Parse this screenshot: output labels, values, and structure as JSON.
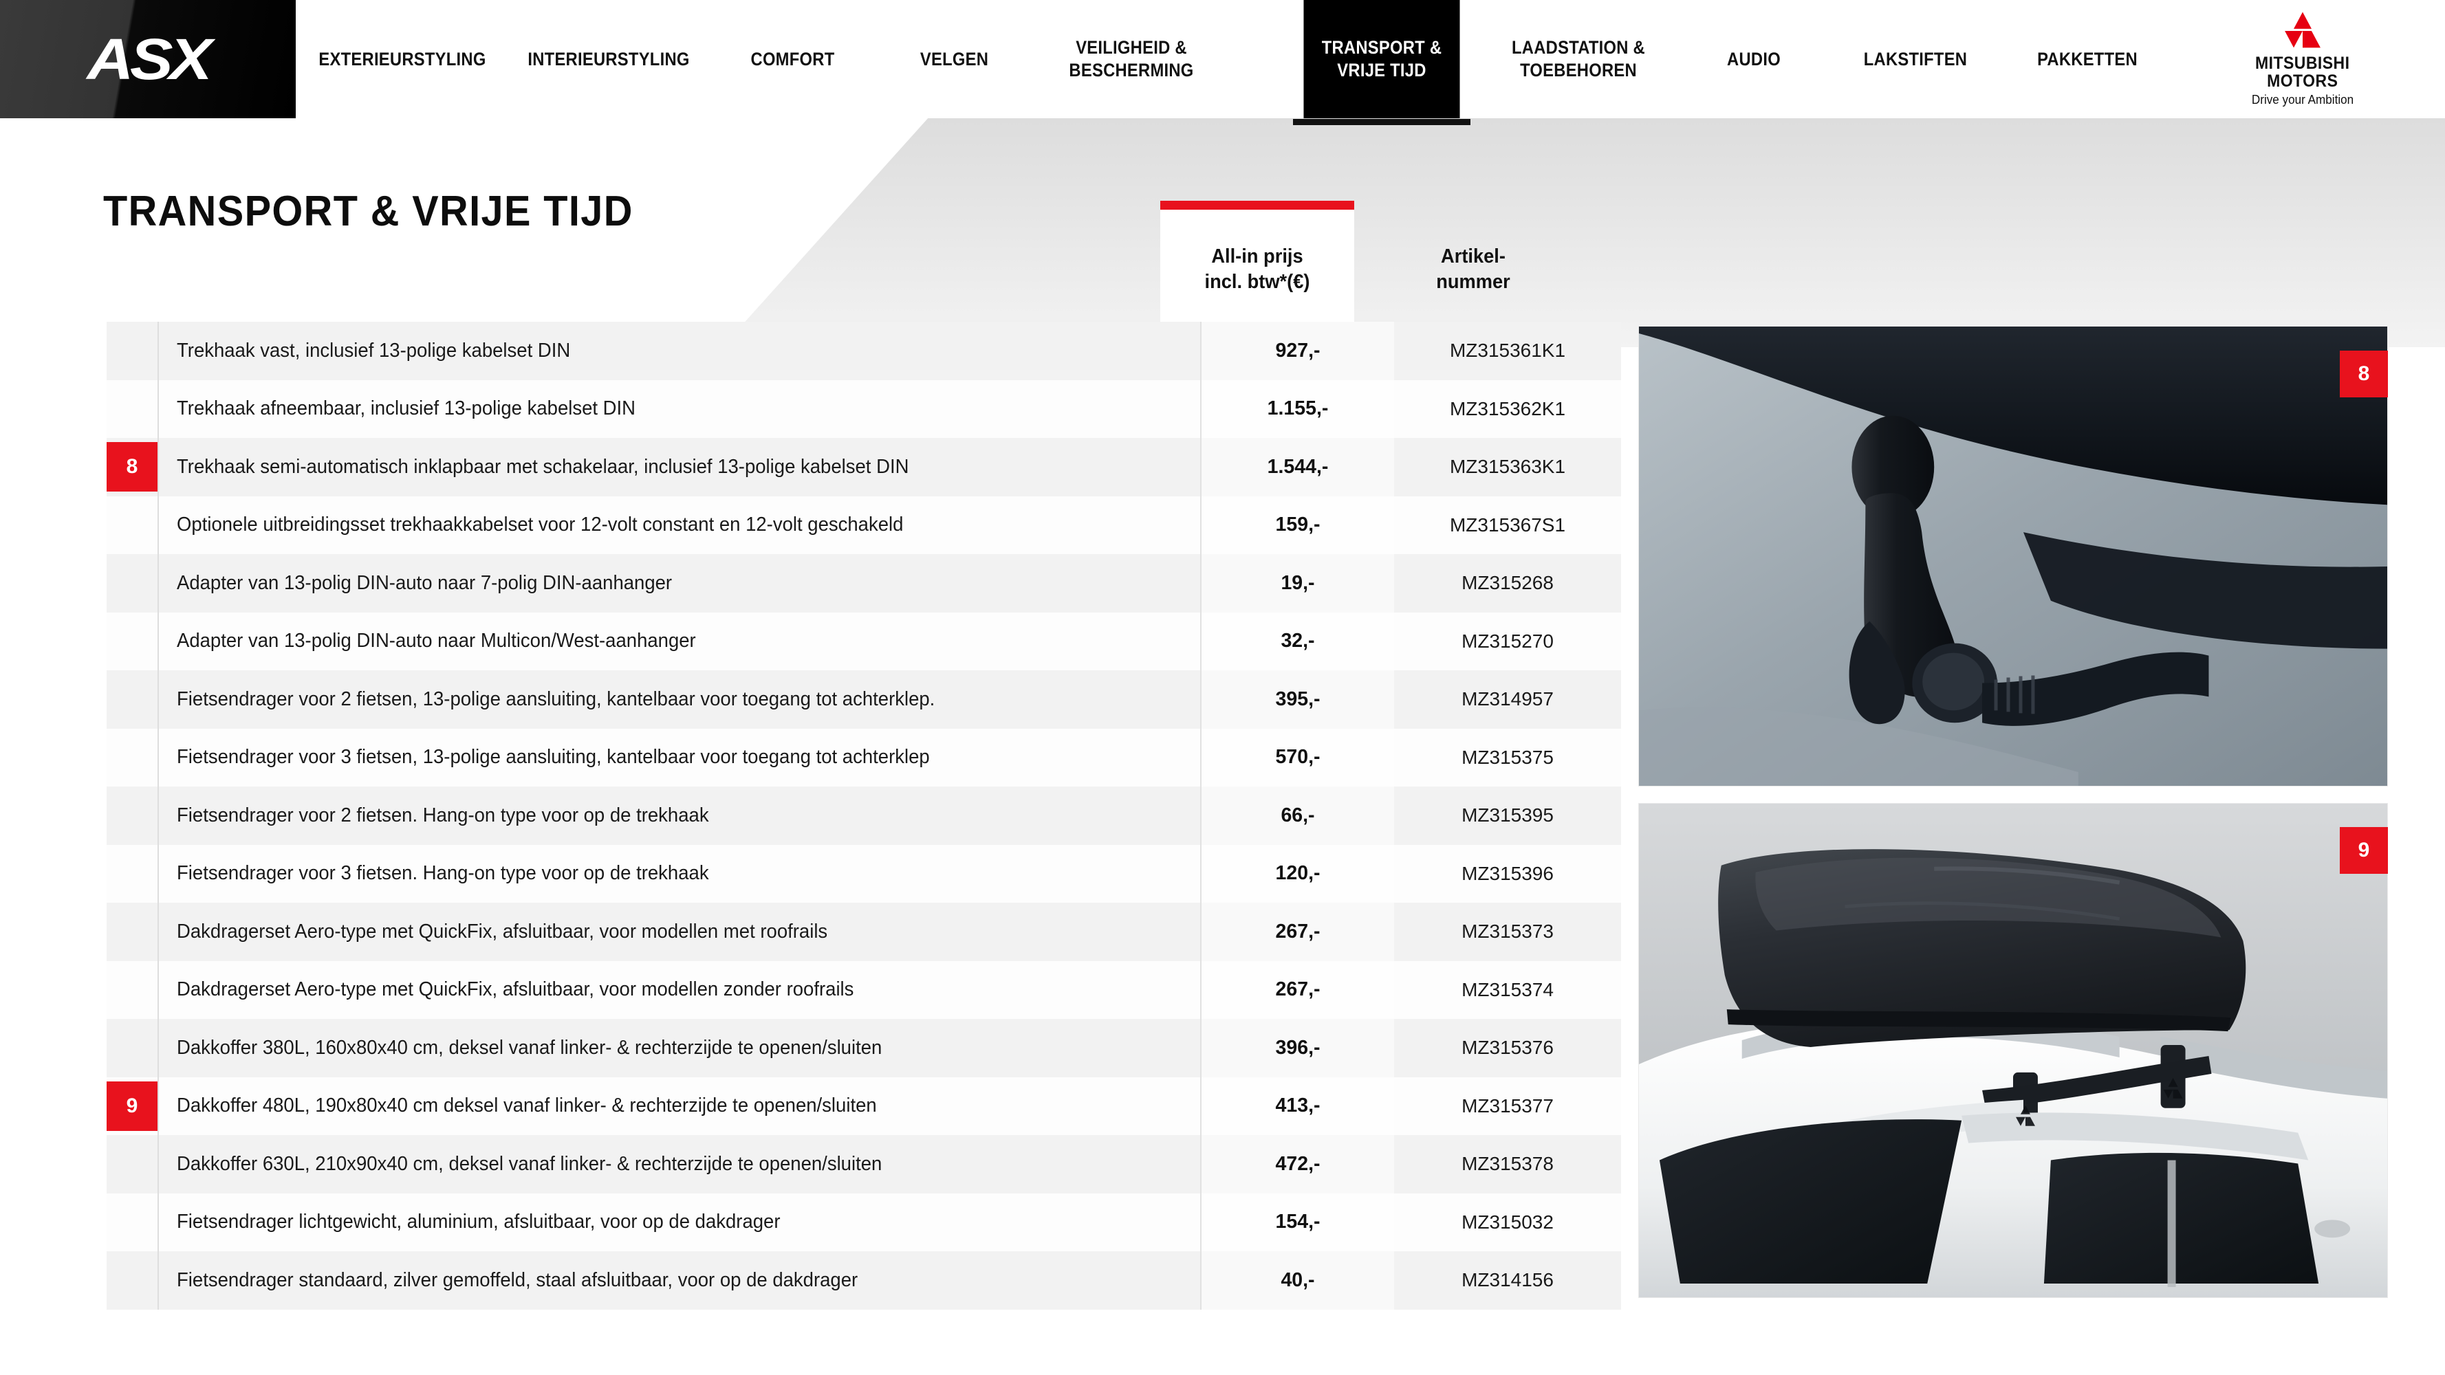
{
  "brand": {
    "model_logo": "ASX",
    "manufacturer_line1": "MITSUBISHI",
    "manufacturer_line2": "MOTORS",
    "tagline": "Drive your Ambition",
    "accent_red": "#e8121d",
    "logo_red": "#e60012"
  },
  "nav": {
    "items": [
      {
        "label": "EXTERIEURSTYLING",
        "active": false
      },
      {
        "label": "INTERIEURSTYLING",
        "active": false
      },
      {
        "label": "COMFORT",
        "active": false
      },
      {
        "label": "VELGEN",
        "active": false
      },
      {
        "label": "VEILIGHEID &\nBESCHERMING",
        "active": false
      },
      {
        "label": "TRANSPORT &\nVRIJE TIJD",
        "active": true
      },
      {
        "label": "LAADSTATION &\nTOEBEHOREN",
        "active": false
      },
      {
        "label": "AUDIO",
        "active": false
      },
      {
        "label": "LAKSTIFTEN",
        "active": false
      },
      {
        "label": "PAKKETTEN",
        "active": false
      }
    ]
  },
  "page": {
    "title": "TRANSPORT & VRIJE TIJD"
  },
  "table": {
    "headers": {
      "description": "",
      "price": "All-in prijs\nincl. btw*(€)",
      "article": "Artikel-\nnummer"
    },
    "rows": [
      {
        "badge": "",
        "description": "Trekhaak vast, inclusief 13-polige kabelset DIN",
        "price": "927,-",
        "article": "MZ315361K1"
      },
      {
        "badge": "",
        "description": "Trekhaak afneembaar, inclusief 13-polige kabelset DIN",
        "price": "1.155,-",
        "article": "MZ315362K1"
      },
      {
        "badge": "8",
        "description": "Trekhaak semi-automatisch inklapbaar met schakelaar, inclusief 13-polige kabelset DIN",
        "price": "1.544,-",
        "article": "MZ315363K1"
      },
      {
        "badge": "",
        "description": "Optionele uitbreidingsset trekhaakkabelset voor 12-volt constant en 12-volt geschakeld",
        "price": "159,-",
        "article": "MZ315367S1"
      },
      {
        "badge": "",
        "description": "Adapter van 13-polig DIN-auto naar 7-polig DIN-aanhanger",
        "price": "19,-",
        "article": "MZ315268"
      },
      {
        "badge": "",
        "description": "Adapter van 13-polig DIN-auto naar Multicon/West-aanhanger",
        "price": "32,-",
        "article": "MZ315270"
      },
      {
        "badge": "",
        "description": "Fietsendrager voor 2 fietsen, 13-polige aansluiting, kantelbaar voor toegang tot achterklep.",
        "price": "395,-",
        "article": "MZ314957"
      },
      {
        "badge": "",
        "description": "Fietsendrager voor 3 fietsen, 13-polige aansluiting, kantelbaar voor toegang tot achterklep",
        "price": "570,-",
        "article": "MZ315375"
      },
      {
        "badge": "",
        "description": "Fietsendrager voor 2 fietsen. Hang-on type voor op de trekhaak",
        "price": "66,-",
        "article": "MZ315395"
      },
      {
        "badge": "",
        "description": "Fietsendrager voor 3 fietsen. Hang-on type voor op de trekhaak",
        "price": "120,-",
        "article": "MZ315396"
      },
      {
        "badge": "",
        "description": "Dakdragerset Aero-type met QuickFix, afsluitbaar, voor modellen met roofrails",
        "price": "267,-",
        "article": "MZ315373"
      },
      {
        "badge": "",
        "description": "Dakdragerset Aero-type met QuickFix, afsluitbaar, voor modellen zonder roofrails",
        "price": "267,-",
        "article": "MZ315374"
      },
      {
        "badge": "",
        "description": "Dakkoffer 380L, 160x80x40 cm, deksel vanaf linker- & rechterzijde te openen/sluiten",
        "price": "396,-",
        "article": "MZ315376"
      },
      {
        "badge": "9",
        "description": "Dakkoffer 480L, 190x80x40 cm deksel vanaf linker- & rechterzijde te openen/sluiten",
        "price": "413,-",
        "article": "MZ315377"
      },
      {
        "badge": "",
        "description": "Dakkoffer 630L, 210x90x40 cm, deksel vanaf linker- & rechterzijde te openen/sluiten",
        "price": "472,-",
        "article": "MZ315378"
      },
      {
        "badge": "",
        "description": "Fietsendrager lichtgewicht, aluminium, afsluitbaar, voor op de dakdrager",
        "price": "154,-",
        "article": "MZ315032"
      },
      {
        "badge": "",
        "description": "Fietsendrager standaard, zilver gemoffeld, staal afsluitbaar, voor op de dakdrager",
        "price": "40,-",
        "article": "MZ314156"
      }
    ]
  },
  "photos": [
    {
      "badge": "8",
      "alt": "tow-bar-detail-photo"
    },
    {
      "badge": "9",
      "alt": "roof-box-on-car-photo"
    }
  ]
}
